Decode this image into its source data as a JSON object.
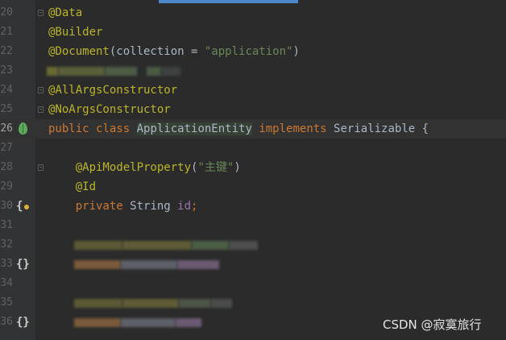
{
  "editor": {
    "lines": [
      {
        "n": "20",
        "tokens": [
          {
            "t": "@Data",
            "c": "ann"
          }
        ]
      },
      {
        "n": "21",
        "tokens": [
          {
            "t": "@Builder",
            "c": "ann"
          }
        ]
      },
      {
        "n": "22",
        "tokens": [
          {
            "t": "@Document",
            "c": "ann"
          },
          {
            "t": "(collection = ",
            "c": ""
          },
          {
            "t": "\"application\"",
            "c": "str"
          },
          {
            "t": ")",
            "c": ""
          }
        ]
      },
      {
        "n": "23",
        "tokens": []
      },
      {
        "n": "24",
        "tokens": [
          {
            "t": "@AllArgsConstructor",
            "c": "ann"
          }
        ]
      },
      {
        "n": "25",
        "tokens": [
          {
            "t": "@NoArgsConstructor",
            "c": "ann"
          }
        ]
      },
      {
        "n": "26",
        "tokens": [
          {
            "t": "public ",
            "c": "kw"
          },
          {
            "t": "class ",
            "c": "kw"
          },
          {
            "t": "ApplicationEntity",
            "c": "hl"
          },
          {
            "t": " implements ",
            "c": "kw"
          },
          {
            "t": "Serializable {",
            "c": ""
          }
        ]
      },
      {
        "n": "27",
        "tokens": []
      },
      {
        "n": "28",
        "tokens": [
          {
            "t": "    ",
            "c": ""
          },
          {
            "t": "@ApiModelProperty",
            "c": "ann"
          },
          {
            "t": "(",
            "c": ""
          },
          {
            "t": "\"主键\"",
            "c": "str"
          },
          {
            "t": ")",
            "c": ""
          }
        ]
      },
      {
        "n": "29",
        "tokens": [
          {
            "t": "    ",
            "c": ""
          },
          {
            "t": "@Id",
            "c": "ann"
          }
        ]
      },
      {
        "n": "30",
        "tokens": [
          {
            "t": "    ",
            "c": ""
          },
          {
            "t": "private ",
            "c": "kw"
          },
          {
            "t": "String ",
            "c": ""
          },
          {
            "t": "id",
            "c": "field"
          },
          {
            "t": ";",
            "c": "kw"
          }
        ]
      },
      {
        "n": "31",
        "tokens": []
      },
      {
        "n": "32",
        "tokens": []
      },
      {
        "n": "33",
        "tokens": []
      },
      {
        "n": "34",
        "tokens": []
      },
      {
        "n": "35",
        "tokens": []
      },
      {
        "n": "36",
        "tokens": []
      }
    ]
  },
  "watermark": "CSDN @寂寞旅行",
  "gutter_icons": {
    "26": "spring-bean-icon",
    "30": "structure-key-icon",
    "33": "structure-icon",
    "36": "structure-icon"
  },
  "gutter_glyphs": {
    "30": "{",
    "33": "{}",
    "36": "{}"
  },
  "colors": {
    "background": "#2b2b2b",
    "gutter": "#313335",
    "annotation": "#bbb529",
    "keyword": "#cc7832",
    "string": "#6a8759",
    "field": "#9876aa",
    "text": "#a9b7c6"
  }
}
